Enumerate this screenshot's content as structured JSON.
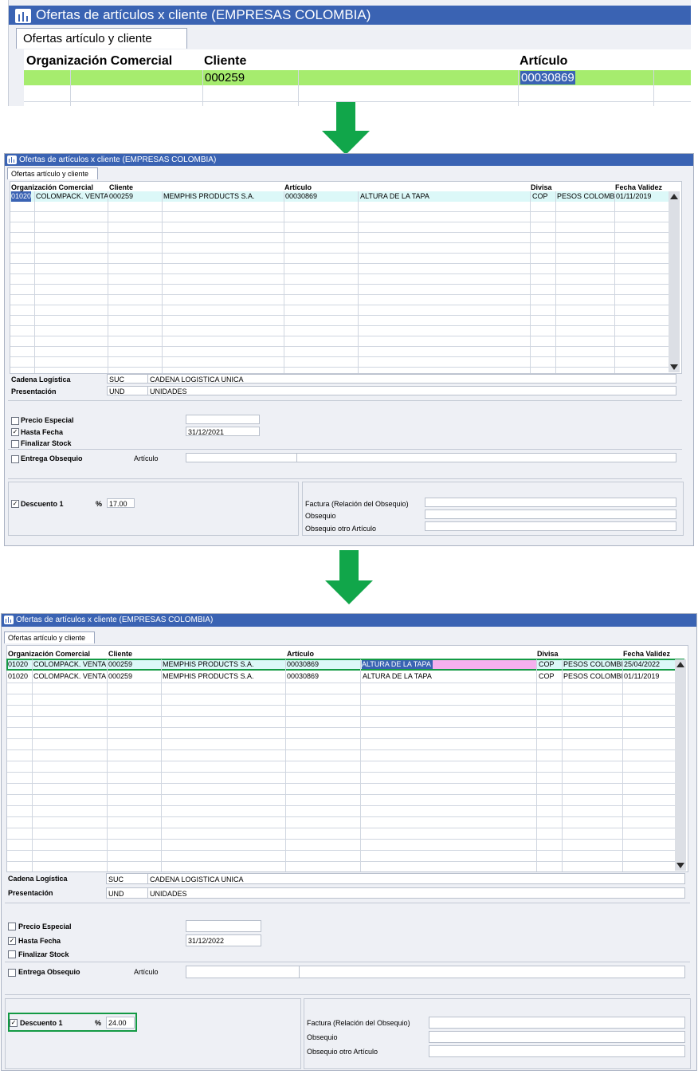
{
  "window_title": "Ofertas de artículos x cliente (EMPRESAS COLOMBIA)",
  "tab_label": "Ofertas artículo y cliente",
  "columns": {
    "org": "Organización Comercial",
    "cliente": "Cliente",
    "articulo": "Artículo",
    "divisa": "Divisa",
    "fecha": "Fecha Validez"
  },
  "zoom": {
    "cliente": "000259",
    "articulo": "00030869"
  },
  "rows": [
    {
      "org_code": "01020",
      "org_name": "COLOMPACK. VENTA (",
      "cliente": "000259",
      "cliente_name": "MEMPHIS PRODUCTS S.A.",
      "articulo": "00030869",
      "articulo_desc": "ALTURA DE LA TAPA",
      "divisa": "COP",
      "divisa_name": "PESOS COLOMBIA",
      "fecha": "25/04/2022"
    },
    {
      "org_code": "01020",
      "org_name": "COLOMPACK. VENTA (",
      "cliente": "000259",
      "cliente_name": "MEMPHIS PRODUCTS S.A.",
      "articulo": "00030869",
      "articulo_desc": "ALTURA DE LA TAPA",
      "divisa": "COP",
      "divisa_name": "PESOS COLOMBIA",
      "fecha": "01/11/2019"
    }
  ],
  "form": {
    "cadena_label": "Cadena Logística",
    "cadena_code": "SUC",
    "cadena_name": "CADENA LOGISTICA UNICA",
    "presentacion_label": "Presentación",
    "presentacion_code": "UND",
    "presentacion_name": "UNIDADES",
    "precio_especial": "Precio Especial",
    "hasta_fecha": "Hasta Fecha",
    "finalizar_stock": "Finalizar Stock",
    "entrega_obsequio": "Entrega Obsequio",
    "articulo_label": "Artículo",
    "descuento_label": "Descuento 1",
    "percent": "%",
    "factura_label": "Factura (Relación del Obsequio)",
    "obsequio_label": "Obsequio",
    "obsequio_otro_label": "Obsequio otro Artículo",
    "check_mark": "✓"
  },
  "step1": {
    "hasta_fecha_value": "31/12/2021",
    "descuento_value": "17.00"
  },
  "step2": {
    "hasta_fecha_value": "31/12/2022",
    "descuento_value": "24.00"
  },
  "colors": {
    "titlebar": "#3a63b3",
    "row_highlight": "#dcf8f8",
    "green_row": "#a6ec6e",
    "pink_cell": "#f6b0ee",
    "selection": "#3a63b3",
    "arrow": "#11a64a",
    "callout": "#139a44"
  }
}
